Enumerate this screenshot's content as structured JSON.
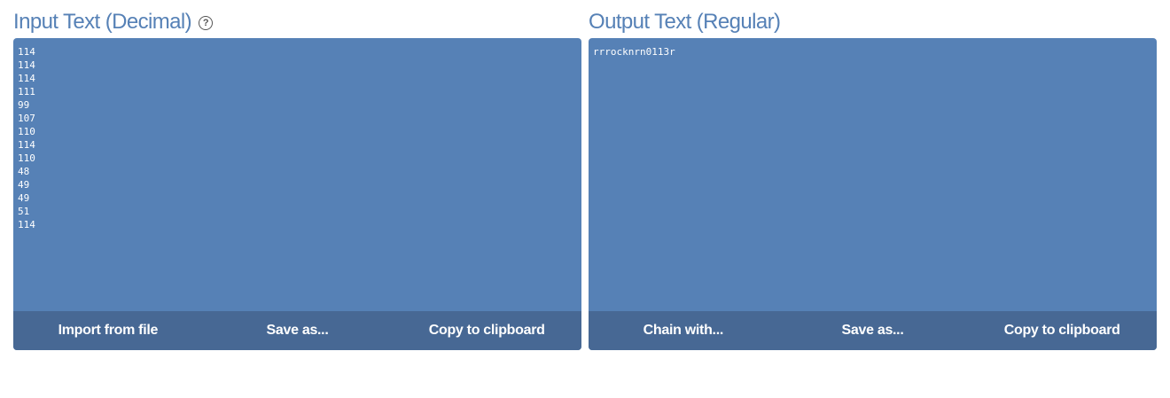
{
  "input": {
    "title": "Input Text (Decimal)",
    "help_icon": "help-circle-icon",
    "lines": [
      "114",
      "114",
      "114",
      "111",
      "99",
      "107",
      "110",
      "114",
      "110",
      "48",
      "49",
      "49",
      "51",
      "114"
    ],
    "buttons": {
      "import": "Import from file",
      "save": "Save as...",
      "copy": "Copy to clipboard"
    }
  },
  "output": {
    "title": "Output Text (Regular)",
    "text": "rrrocknrn0113r",
    "buttons": {
      "chain": "Chain with...",
      "save": "Save as...",
      "copy": "Copy to clipboard"
    }
  },
  "colors": {
    "panel_bg": "#5681b6",
    "action_bar_bg": "#476894",
    "title_color": "#5681b6"
  }
}
